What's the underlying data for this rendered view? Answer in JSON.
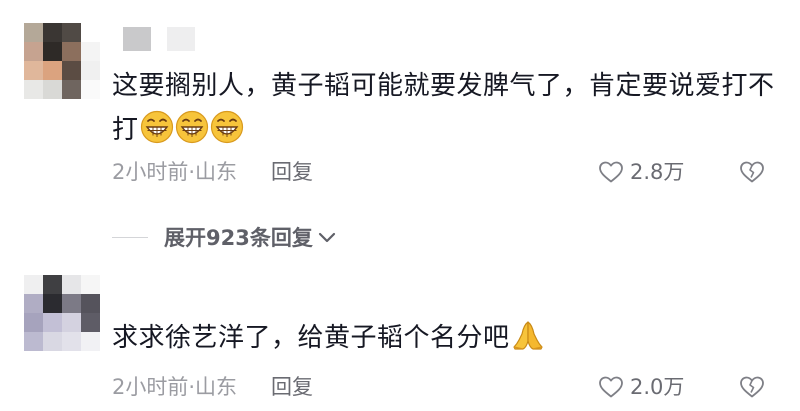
{
  "comments": [
    {
      "text": "这要搁别人，黄子韬可能就要发脾气了，肯定要说爱打不打",
      "emojis": [
        "grin-emoji",
        "grin-emoji",
        "grin-emoji"
      ],
      "time_location": "2小时前·山东",
      "reply_label": "回复",
      "likes": "2.8万"
    },
    {
      "text": "求求徐艺洋了，给黄子韬个名分吧",
      "emojis": [
        "pray-emoji"
      ],
      "time_location": "2小时前·山东",
      "reply_label": "回复",
      "likes": "2.0万"
    }
  ],
  "expand_replies": {
    "label": "展开923条回复"
  },
  "colors": {
    "text_primary": "#161823",
    "text_secondary": "#9b9ca2",
    "emoji_yellow": "#f7c43b"
  }
}
